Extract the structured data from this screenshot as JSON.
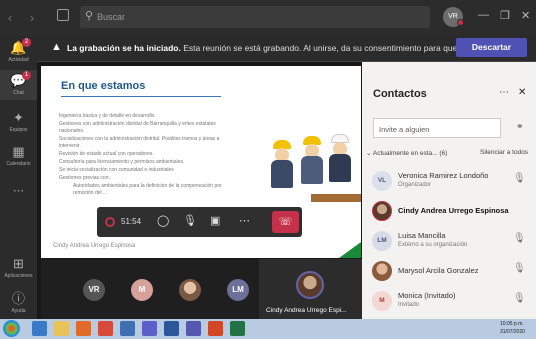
{
  "titlebar": {
    "search_placeholder": "Buscar",
    "user_initials": "VR"
  },
  "rail": {
    "items": [
      {
        "label": "Actividad",
        "badge": "2"
      },
      {
        "label": "Chat",
        "badge": "1"
      },
      {
        "label": "Equipos"
      },
      {
        "label": "Calendario"
      },
      {
        "label": "Aplicaciones"
      },
      {
        "label": "Ayuda"
      }
    ]
  },
  "banner": {
    "bold_text": "La grabación se ha iniciado.",
    "text": "Esta reunión se está grabando. Al unirse, da su consentimiento para que s...",
    "dismiss_label": "Descartar"
  },
  "slide": {
    "title": "En que estamos",
    "bullets": [
      "Ingeniería básica y de detalle en desarrollo.",
      "Gestiones con administración distrital de Barranquilla y entes estatales nacionales.",
      "Socializaciones con la administración distrital. Posibles tramos y áreas a intervenir.",
      "Revisión de estado actual con operadores.",
      "Consultoría para licenciamiento y permisos ambientales.",
      "Se inicia socialización con comunidad e industriales",
      "Gestiones previas con:"
    ],
    "sub_bullet": "Autoridades ambientales para la definición de la compensación por remoción del ...",
    "footer": "Cindy Andrea Urrego Espinosa"
  },
  "controls": {
    "timer": "51:54"
  },
  "participants": [
    {
      "initials": "VR",
      "color": "#555555"
    },
    {
      "initials": "M",
      "color": "#d6a198"
    },
    {
      "initials": "LM",
      "color": "#6b6f9a"
    }
  ],
  "active_tile": {
    "name": "Cindy Andrea Urrego Espi..."
  },
  "panel": {
    "title": "Contactos",
    "invite_placeholder": "Invite a alguien",
    "section_label": "Actualmente en esta... (6)",
    "mute_all_label": "Silenciar a todos",
    "contacts": [
      {
        "initials": "VL",
        "name": "Veronica Ramirez Londoño",
        "role": "Organizador",
        "avatar_bg": "#dce0ea",
        "avatar_fg": "#555b77"
      },
      {
        "initials": "",
        "name": "Cindy Andrea Urrego Espinosa",
        "role": "",
        "bold": true
      },
      {
        "initials": "LM",
        "name": "Luisa Mancilla",
        "role": "Externo a su organización",
        "avatar_bg": "#d7dbe8",
        "avatar_fg": "#4e557a"
      },
      {
        "initials": "",
        "name": "Marysol Arcila Gonzalez",
        "role": ""
      },
      {
        "initials": "M",
        "name": "Monica (Invitado)",
        "role": "Invitado",
        "avatar_bg": "#f4d7d3",
        "avatar_fg": "#a4423a"
      }
    ]
  },
  "taskbar": {
    "time": "10:05 p.m.",
    "date": "31/07/2020"
  },
  "colors": {
    "accent": "#4f52b2",
    "hangup": "#c4314b",
    "title_blue": "#1e5a8a"
  }
}
